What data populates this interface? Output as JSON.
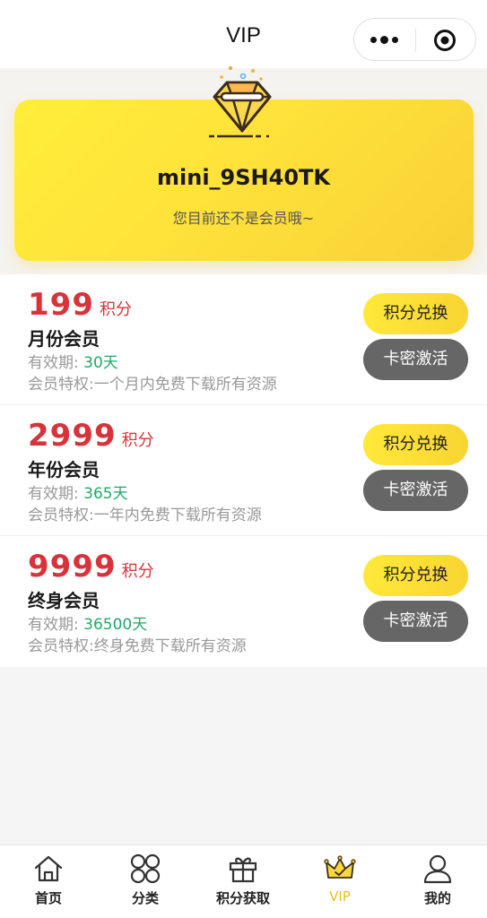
{
  "navbar": {
    "title": "VIP",
    "more_icon": "more-dots-icon",
    "close_icon": "target-circle-icon"
  },
  "header": {
    "icon": "diamond-icon",
    "username": "mini_9SH40TK",
    "status": "您目前还不是会员哦~"
  },
  "colors": {
    "accent_yellow": "#ffe23a",
    "price_red": "#d8333a",
    "days_green": "#22a86b",
    "activate_gray": "#666666",
    "active_tab": "#e7c21c"
  },
  "plans": [
    {
      "price": "199",
      "unit": "积分",
      "name": "月份会员",
      "validity_label": "有效期:",
      "validity_value": "30天",
      "privilege": "会员特权:一个月内免费下载所有资源",
      "redeem_label": "积分兑换",
      "activate_label": "卡密激活"
    },
    {
      "price": "2999",
      "unit": "积分",
      "name": "年份会员",
      "validity_label": "有效期:",
      "validity_value": "365天",
      "privilege": "会员特权:一年内免费下载所有资源",
      "redeem_label": "积分兑换",
      "activate_label": "卡密激活"
    },
    {
      "price": "9999",
      "unit": "积分",
      "name": "终身会员",
      "validity_label": "有效期:",
      "validity_value": "36500天",
      "privilege": "会员特权:终身免费下载所有资源",
      "redeem_label": "积分兑换",
      "activate_label": "卡密激活"
    }
  ],
  "tabbar": {
    "items": [
      {
        "label": "首页",
        "icon": "home-icon",
        "active": false
      },
      {
        "label": "分类",
        "icon": "grid-circles-icon",
        "active": false
      },
      {
        "label": "积分获取",
        "icon": "gift-icon",
        "active": false
      },
      {
        "label": "VIP",
        "icon": "crown-icon",
        "active": true
      },
      {
        "label": "我的",
        "icon": "user-icon",
        "active": false
      }
    ]
  }
}
